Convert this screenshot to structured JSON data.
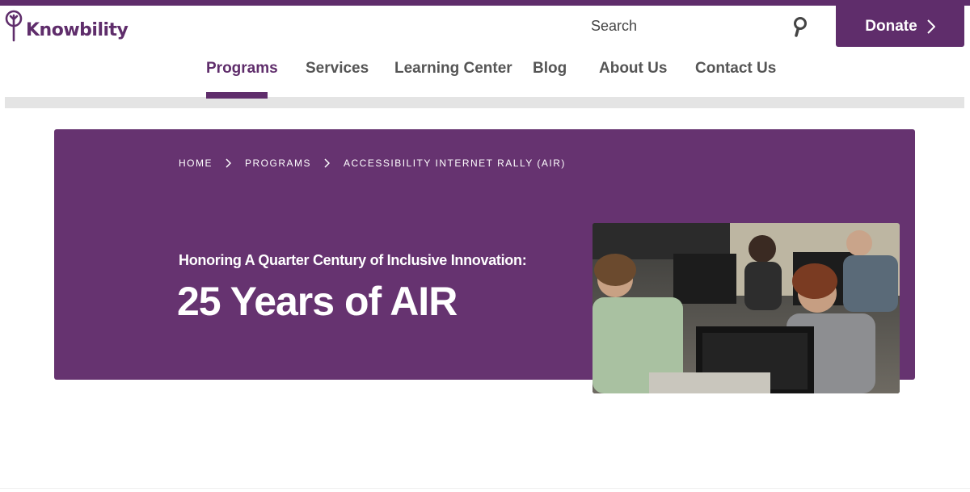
{
  "brand": {
    "name": "Knowbility",
    "accent_color": "#5f2d6b",
    "hero_color": "#663370"
  },
  "header": {
    "search_label": "Search",
    "search_icon": "search-icon",
    "donate_label": "Donate",
    "donate_icon": "chevron-right-icon"
  },
  "nav": {
    "items": [
      {
        "label": "Programs",
        "active": true
      },
      {
        "label": "Services",
        "active": false
      },
      {
        "label": "Learning Center",
        "active": false
      },
      {
        "label": "Blog",
        "active": false
      },
      {
        "label": "About Us",
        "active": false
      },
      {
        "label": "Contact Us",
        "active": false
      }
    ]
  },
  "breadcrumb": {
    "items": [
      "HOME",
      "PROGRAMS",
      "ACCESSIBILITY INTERNET RALLY (AIR)"
    ],
    "separator_icon": "chevron-right-icon"
  },
  "hero": {
    "subtitle": "Honoring A Quarter Century of Inclusive Innovation:",
    "title": "25 Years of AIR",
    "photo": "people-at-computers-photo"
  }
}
